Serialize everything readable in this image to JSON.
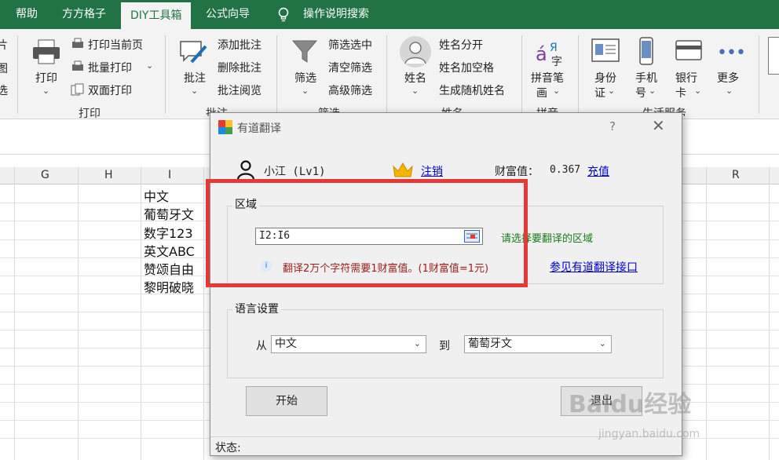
{
  "tabs": [
    {
      "label": "帮助"
    },
    {
      "label": "方方格子"
    },
    {
      "label": "DIY工具箱"
    },
    {
      "label": "公式向导"
    },
    {
      "label": "操作说明搜索"
    }
  ],
  "ribbon": {
    "left_partial": [
      "片",
      "图",
      "选"
    ],
    "print": {
      "label": "打印",
      "print_current": "打印当前页",
      "batch_print": "批量打印",
      "duplex_print": "双面打印",
      "group": "打印"
    },
    "comment": {
      "label": "批注",
      "add": "添加批注",
      "delete": "删除批注",
      "read": "批注阅览",
      "group": "批注"
    },
    "filter": {
      "label": "筛选",
      "filter_selected": "筛选选中",
      "clear": "清空筛选",
      "advanced": "高级筛选",
      "group": "筛选"
    },
    "name": {
      "label": "姓名",
      "split": "姓名分开",
      "add_space": "姓名加空格",
      "random": "生成随机姓名",
      "group": "姓名"
    },
    "pinyin": {
      "label1": "拼音笔",
      "label2": "画",
      "group": "拼音"
    },
    "life": {
      "id1": "身份",
      "id2": "证",
      "phone1": "手机",
      "phone2": "号",
      "bank1": "银行",
      "bank2": "卡",
      "more": "更多",
      "group": "生活服务"
    }
  },
  "grid": {
    "columns": [
      "G",
      "H",
      "I",
      "R"
    ],
    "cells": [
      "中文",
      "葡萄牙文",
      "数字123",
      "英文ABC",
      "赞颂自由",
      "黎明破晓"
    ]
  },
  "dialog": {
    "title": "有道翻译",
    "help": "?",
    "close": "✕",
    "user": "小江 (Lv1)",
    "logout": "注销",
    "wealth_label": "财富值：",
    "wealth_value": "0.367",
    "recharge": "充值",
    "region_legend": "区域",
    "range_value": "I2:I6",
    "range_hint": "请选择要翻译的区域",
    "info_text": "翻译2万个字符需要1财富值。(1财富值=1元)",
    "api_link": "参见有道翻译接口",
    "lang_legend": "语言设置",
    "from_label": "从",
    "from_value": "中文",
    "to_label": "到",
    "to_value": "葡萄牙文",
    "start": "开始",
    "exit": "退出",
    "status": "状态:"
  },
  "watermark": {
    "brand": "Baidu经验",
    "url": "jingyan.baidu.com"
  },
  "colors": {
    "excel_green": "#217346",
    "highlight_red": "#e53935",
    "link_blue": "#0000cc",
    "hint_green": "#1a7a1a",
    "info_red": "#9b1c1c"
  }
}
